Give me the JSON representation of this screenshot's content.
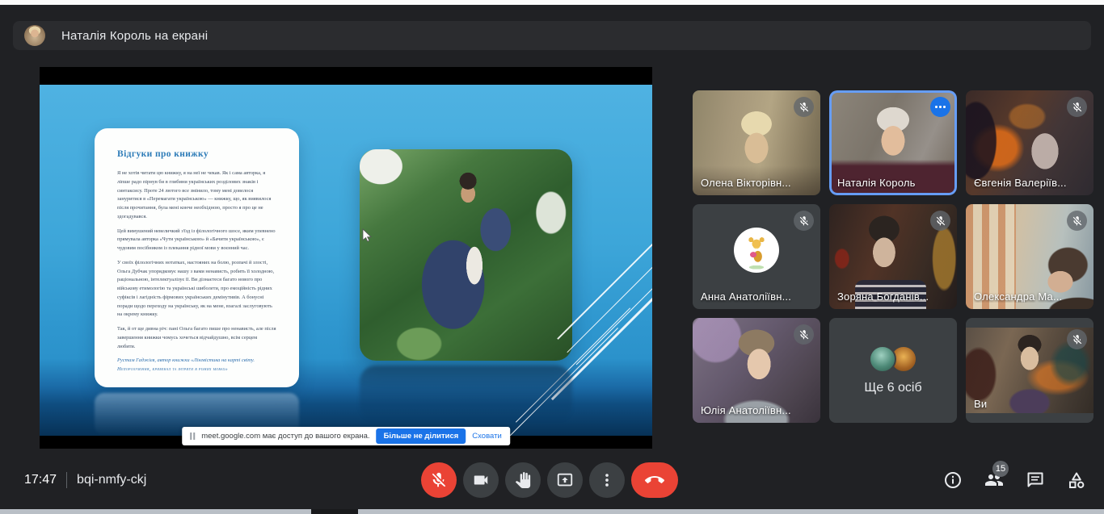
{
  "banner": {
    "text": "Наталія Король на екрані"
  },
  "presentation": {
    "title": "Відгуки про книжку",
    "paragraphs": [
      "Я не хотів читати цю книжку, я на неї не чекав. Як і сама авторка, я ліпше радо пірнув би в глибини українських розділових знаків і синтаксису. Проте 24 лютого все змінило, тому мені довелося зануритися в «Перемагати українською» — книжку, що, як виявилося після прочитання, була мені конче необхідною, просто я про це не здогадувався.",
      "Цей вимушений невеличкий з'їзд із філологічного шосе, яким упевнено прямувала авторка «Чути українською» й «Бачити українською», є чудовим посібником із плекання рідної мови у воєнний час.",
      "У своїх філологічних нотатках, настояних на болю, розпачі й злості, Ольга Дубчак упорядковує нашу з вами ненависть, робить її холодною, раціональною, інтелектуалізує її. Ви дізнаєтеся багато нового про військову етимологію та українські шиболети, про емоційність рідних суфіксів і лагідність фірмових українських демінутивів. А бонусні поради щодо переходу на українську, як на мене, взагалі заслуговують на окрему книжку.",
      "Так, й от ще дивна річ: пані Ольга багато пише про ненависть, але після завершення книжки чомусь хочеться відчайдушно, всім серцем любити."
    ],
    "attribution_line1": "Рустам Гаджієв, автор книжки «Лінгвістика на карті світу.",
    "attribution_line2": "Непорозуміння, кримінал та інтриги в різних мовах»"
  },
  "share_notice": {
    "text": "meet.google.com має доступ до вашого екрана.",
    "stop_button": "Більше не ділитися",
    "hide_link": "Сховати"
  },
  "participants": [
    {
      "name": "Олена Вікторівн...",
      "muted": true
    },
    {
      "name": "Наталія Король",
      "muted": false,
      "active": true
    },
    {
      "name": "Євгенія Валеріїв...",
      "muted": true
    },
    {
      "name": "Анна Анатоліївн...",
      "muted": true
    },
    {
      "name": "Зоряна Богданів...",
      "muted": true
    },
    {
      "name": "Олександра Ма...",
      "muted": true
    },
    {
      "name": "Юлія Анатоліївн...",
      "muted": true
    },
    {
      "name": "Ще 6 осіб",
      "overflow_tile": true
    },
    {
      "name": "Ви",
      "muted": true
    }
  ],
  "bottom_bar": {
    "time": "17:47",
    "meeting_code": "bqi-nmfy-ckj",
    "people_badge": "15"
  },
  "colors": {
    "accent_blue": "#1a73e8",
    "active_tile_border": "#669df6",
    "danger_red": "#ea4335",
    "tile_background": "#3c4043",
    "page_background": "#202124"
  }
}
